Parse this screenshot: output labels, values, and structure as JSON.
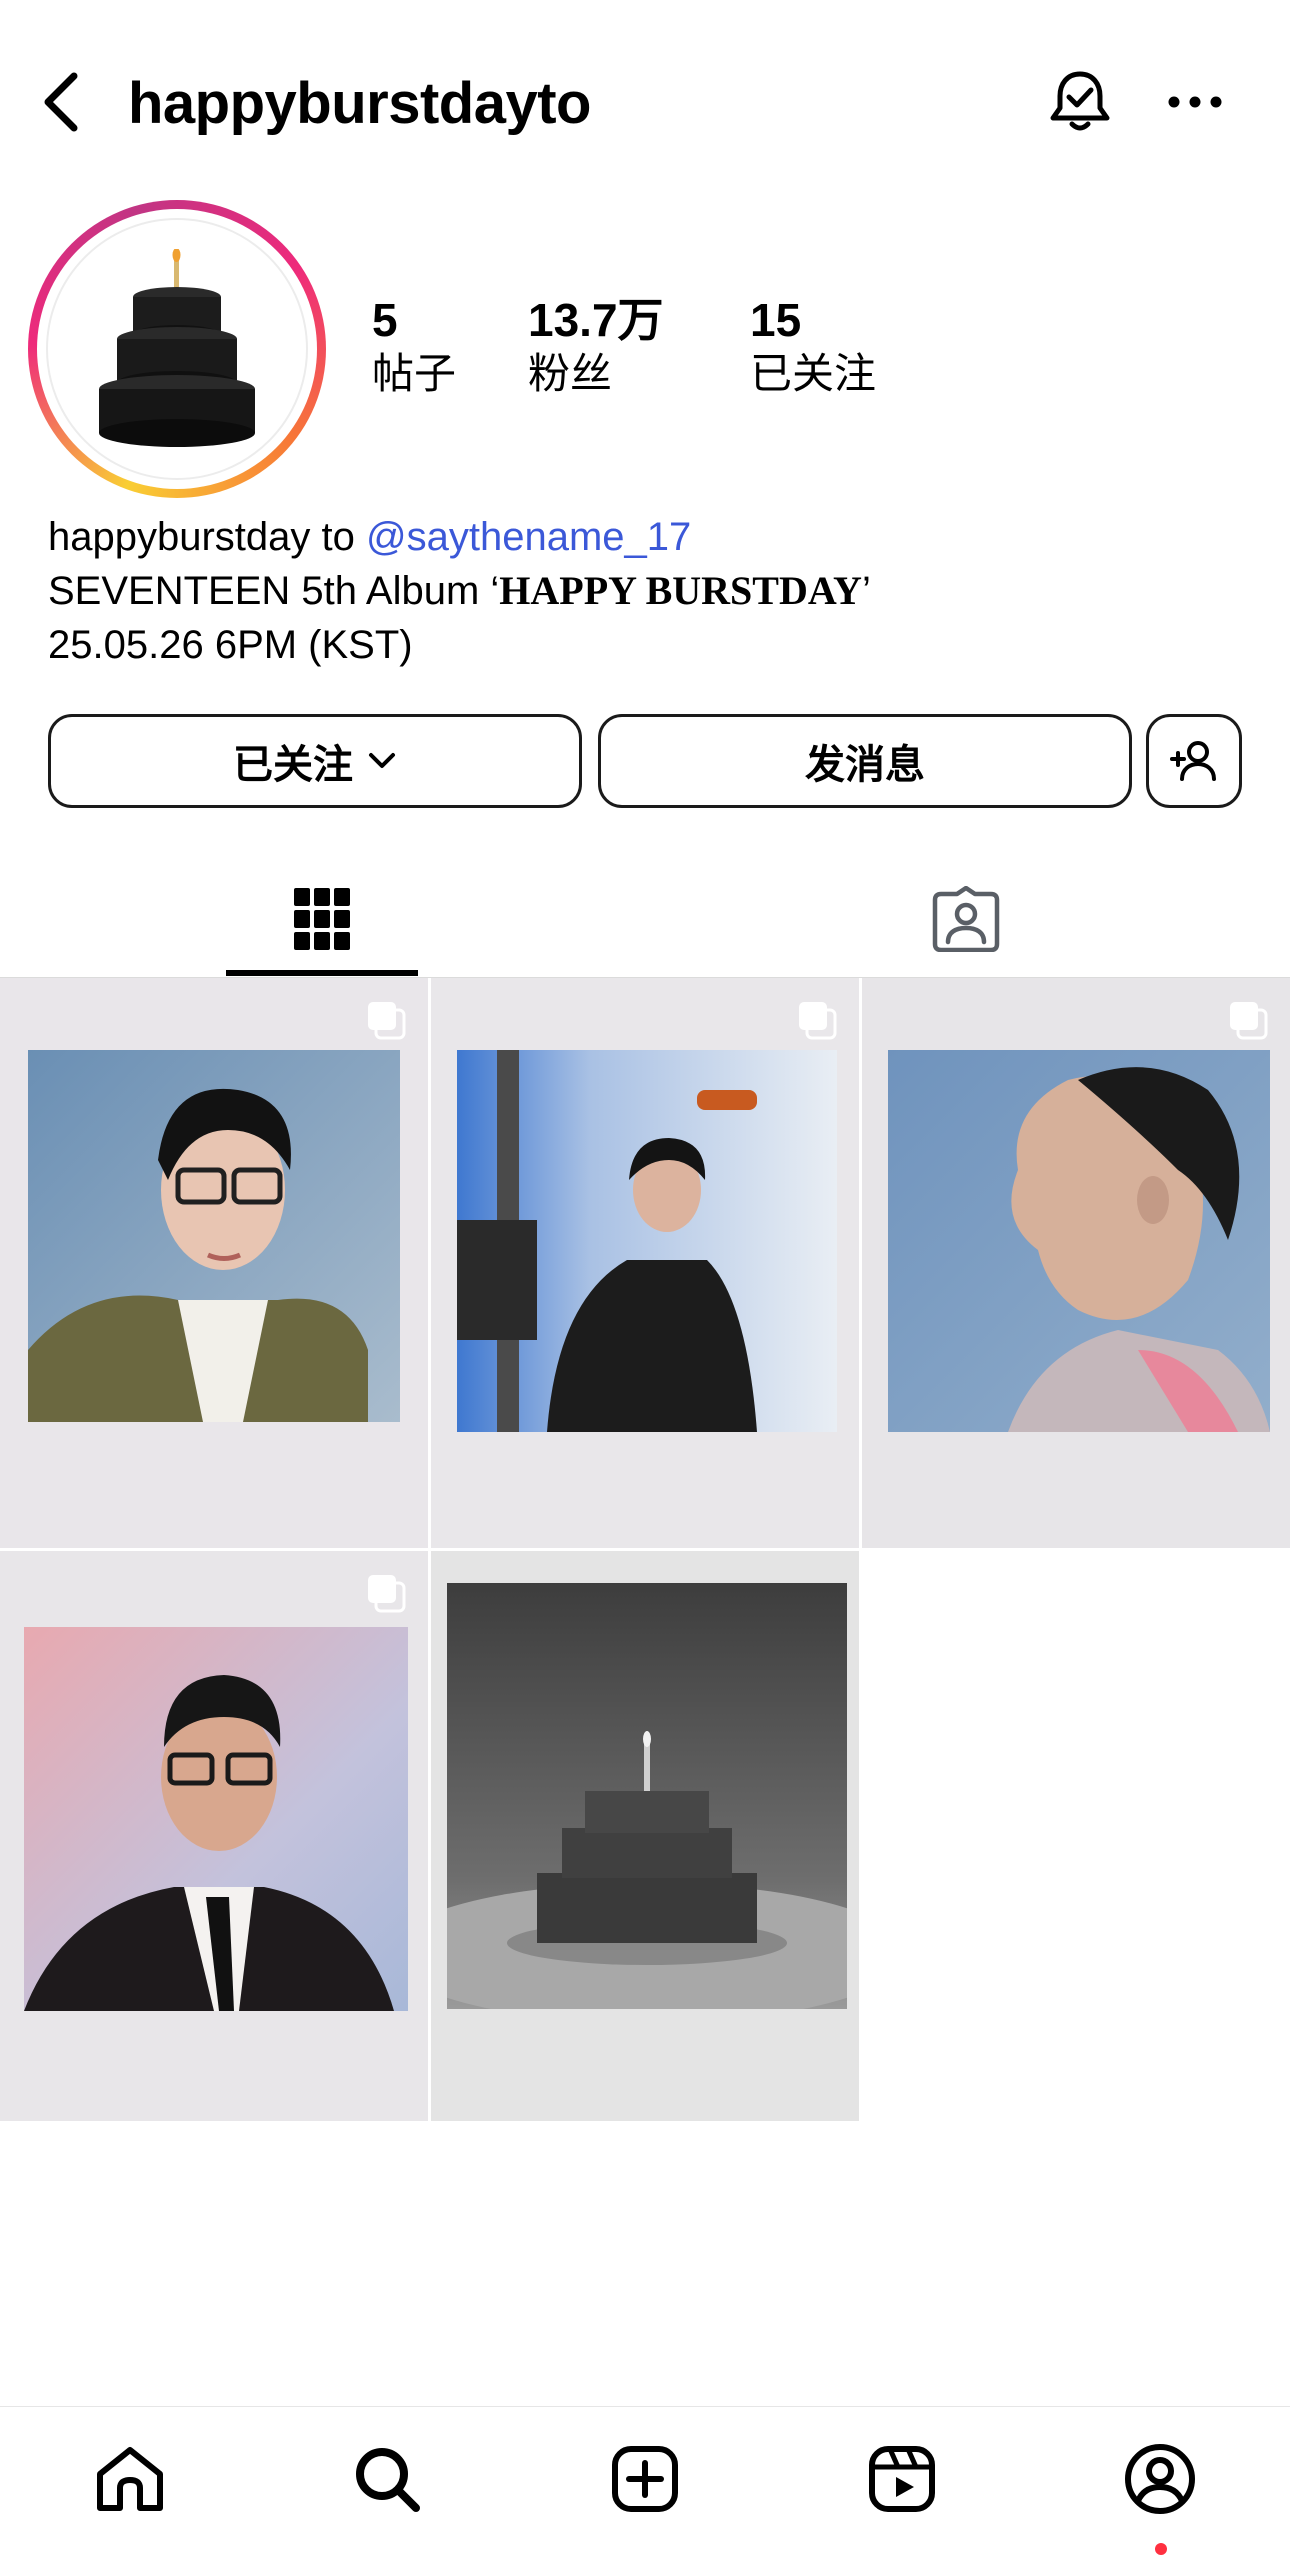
{
  "header": {
    "username": "happyburstdayto",
    "back_icon": "chevron-left-icon",
    "notify_icon": "bell-check-icon",
    "more_icon": "more-horizontal-icon"
  },
  "profile": {
    "avatar_description": "black-three-tier-cake-with-candle",
    "stats": {
      "posts": {
        "value": "5",
        "label": "帖子"
      },
      "followers": {
        "value": "13.7万",
        "label": "粉丝"
      },
      "following": {
        "value": "15",
        "label": "已关注"
      }
    },
    "bio": {
      "line1_prefix": "happyburstday to ",
      "line1_mention": "@saythename_17",
      "line2_prefix": "SEVENTEEN 5th Album ‘",
      "line2_title": "HAPPY BURSTDAY",
      "line2_suffix": "’",
      "line3": "25.05.26 6PM (KST)"
    }
  },
  "actions": {
    "following_label": "已关注",
    "message_label": "发消息",
    "suggest_icon": "add-person-icon"
  },
  "tabs": [
    {
      "name": "posts-grid",
      "icon": "grid-icon",
      "active": true
    },
    {
      "name": "tagged",
      "icon": "tagged-person-icon",
      "active": false
    }
  ],
  "posts": [
    {
      "name": "post-1",
      "multi": true,
      "subject": "polaroid-portrait-glasses-olive-jacket"
    },
    {
      "name": "post-2",
      "multi": true,
      "subject": "polaroid-full-body-black-jacket"
    },
    {
      "name": "post-3",
      "multi": true,
      "subject": "polaroid-side-profile-gray-suit"
    },
    {
      "name": "post-4",
      "multi": true,
      "subject": "polaroid-portrait-glasses-black-suit-tie"
    },
    {
      "name": "post-5",
      "multi": false,
      "subject": "polaroid-black-and-white-cake"
    }
  ],
  "bottom_nav": [
    {
      "name": "home",
      "icon": "home-icon"
    },
    {
      "name": "search",
      "icon": "search-icon"
    },
    {
      "name": "create",
      "icon": "plus-square-icon"
    },
    {
      "name": "reels",
      "icon": "reels-icon"
    },
    {
      "name": "profile",
      "icon": "profile-icon",
      "has_notification_dot": true
    }
  ],
  "colors": {
    "mention": "#3b58d8",
    "ring_gradient": [
      "#f9ce34",
      "#ee2a7b",
      "#c13584"
    ],
    "notification_dot": "#ff3040"
  }
}
